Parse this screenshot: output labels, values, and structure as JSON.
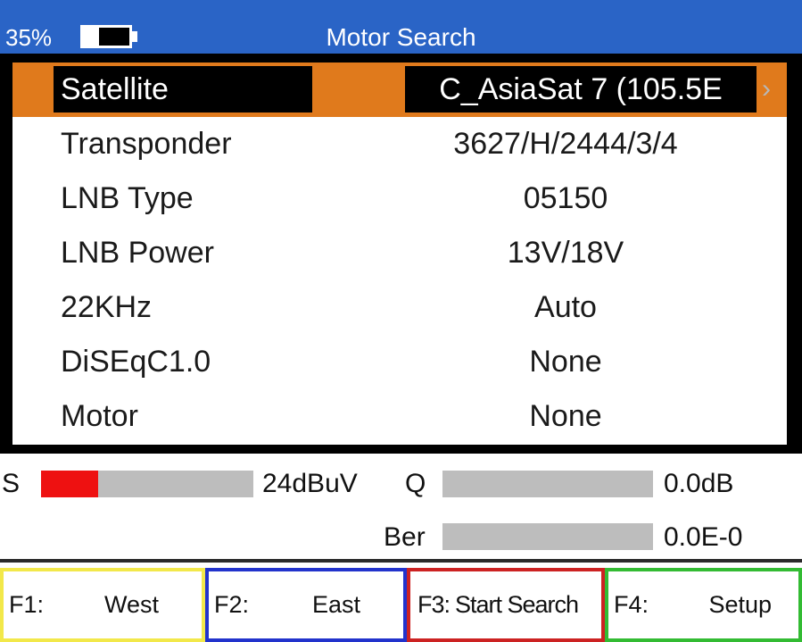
{
  "status": {
    "battery_percent_label": "35%",
    "battery_level": 0.35,
    "title": "Motor Search"
  },
  "menu": {
    "items": [
      {
        "label": "Satellite",
        "value": "C_AsiaSat 7 (105.5E",
        "selected": true
      },
      {
        "label": "Transponder",
        "value": "3627/H/2444/3/4"
      },
      {
        "label": "LNB Type",
        "value": "05150"
      },
      {
        "label": "LNB Power",
        "value": "13V/18V"
      },
      {
        "label": "22KHz",
        "value": "Auto"
      },
      {
        "label": "DiSEqC1.0",
        "value": "None"
      },
      {
        "label": "Motor",
        "value": "None"
      }
    ],
    "chevron": "›"
  },
  "signal": {
    "strength_label": "S",
    "strength_value": "24dBuV",
    "strength_level": 0.27,
    "quality_label": "Q",
    "quality_value": "0.0dB",
    "quality_level": 0,
    "ber_label": "Ber",
    "ber_value": "0.0E-0",
    "ber_level": 0
  },
  "function_keys": [
    {
      "key": "F1:",
      "label": "West",
      "color": "#f2e84a"
    },
    {
      "key": "F2:",
      "label": "East",
      "color": "#2233cc"
    },
    {
      "key": "F3:",
      "label": "Start Search",
      "color": "#cc2222"
    },
    {
      "key": "F4:",
      "label": "Setup",
      "color": "#33bb33"
    }
  ],
  "colors": {
    "header": "#2a64c6",
    "selected_row": "#e07a1c",
    "signal_bar": "#ee1111",
    "bar_bg": "#bdbdbd"
  }
}
